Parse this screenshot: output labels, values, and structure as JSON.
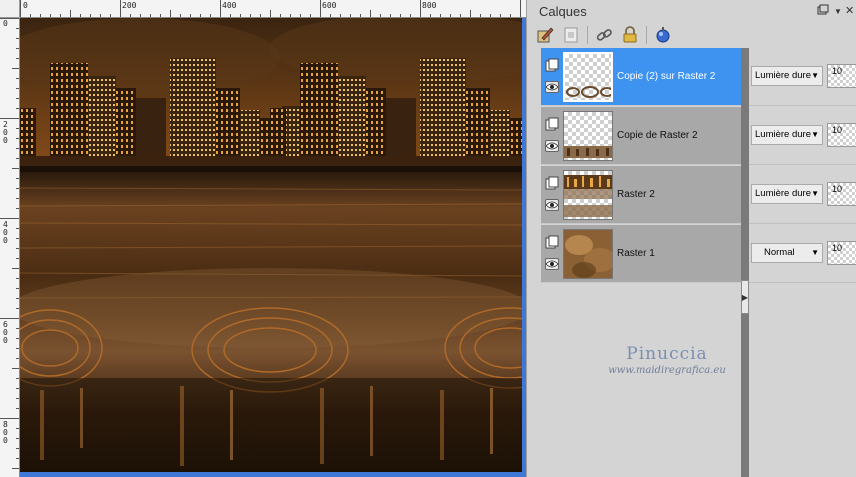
{
  "ruler": {
    "h_labels": [
      "0",
      "200",
      "400",
      "600",
      "800"
    ],
    "v_labels": [
      "0",
      "2 0 0",
      "4 0 0",
      "6 0 0",
      "8 0 0"
    ]
  },
  "canvas": {
    "image_description_icon": "night-city-reflection-artwork"
  },
  "panel": {
    "title": "Calques",
    "menu_icon": "panel-menu-icon",
    "close_label": "✕",
    "toolbar": [
      {
        "name": "new-vector-layer-icon"
      },
      {
        "name": "new-raster-layer-icon"
      },
      {
        "name": "link-layer-icon"
      },
      {
        "name": "lock-layer-icon"
      },
      {
        "name": "layer-effects-icon"
      }
    ]
  },
  "layers": [
    {
      "name": "Copie (2) sur Raster 2",
      "blend": "Lumière dure",
      "opacity": "10",
      "selected": true
    },
    {
      "name": "Copie de Raster 2",
      "blend": "Lumière dure",
      "opacity": "10",
      "selected": false
    },
    {
      "name": "Raster 2",
      "blend": "Lumière dure",
      "opacity": "10",
      "selected": false
    },
    {
      "name": "Raster 1",
      "blend": "Normal",
      "opacity": "10",
      "selected": false
    }
  ],
  "watermark": {
    "name": "Pinuccia",
    "url": "www.maidiregrafica.eu"
  },
  "colors": {
    "selection": "#3f93f0",
    "layer_bg": "#a8a8a8",
    "window_frame": "#3f78d6"
  }
}
